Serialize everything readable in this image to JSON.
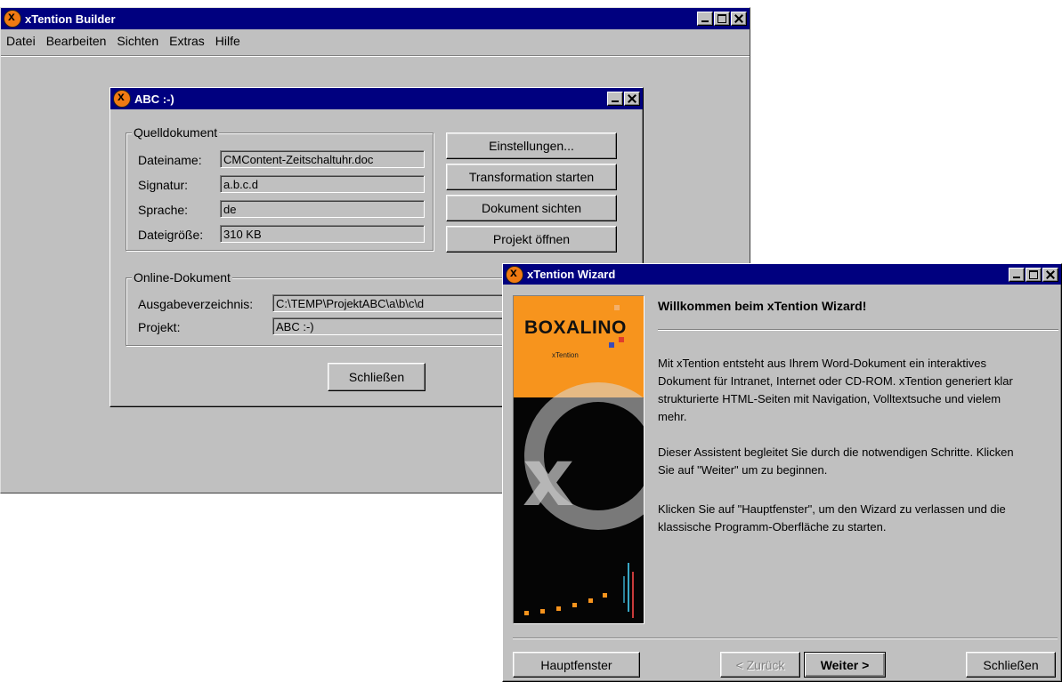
{
  "main_window": {
    "title": "xTention Builder",
    "menu": [
      "Datei",
      "Bearbeiten",
      "Sichten",
      "Extras",
      "Hilfe"
    ]
  },
  "abc_dialog": {
    "title": "ABC :-)",
    "source_group": {
      "label": "Quelldokument",
      "fields": [
        {
          "label": "Dateiname:",
          "value": "CMContent-Zeitschaltuhr.doc"
        },
        {
          "label": "Signatur:",
          "value": "a.b.c.d"
        },
        {
          "label": "Sprache:",
          "value": "de"
        },
        {
          "label": "Dateigröße:",
          "value": "310 KB"
        }
      ]
    },
    "buttons": [
      "Einstellungen...",
      "Transformation starten",
      "Dokument sichten",
      "Projekt öffnen"
    ],
    "online_group": {
      "label": "Online-Dokument",
      "fields": [
        {
          "label": "Ausgabeverzeichnis:",
          "value": "C:\\TEMP\\ProjektABC\\a\\b\\c\\d"
        },
        {
          "label": "Projekt:",
          "value": "ABC :-)"
        }
      ]
    },
    "close_label": "Schließen"
  },
  "wizard": {
    "title": "xTention Wizard",
    "heading": "Willkommen beim xTention Wizard!",
    "brand_name": "BOXALINO",
    "brand_sub": "xTention",
    "paragraph1": [
      "Mit xTention entsteht aus Ihrem Word-Dokument ein interaktives",
      "Dokument für Intranet, Internet oder CD-ROM. xTention generiert klar",
      "strukturierte HTML-Seiten mit Navigation, Volltextsuche und vielem",
      "mehr."
    ],
    "paragraph2": [
      "Dieser Assistent begleitet Sie durch die notwendigen Schritte. Klicken",
      "Sie auf \"Weiter\" um zu beginnen."
    ],
    "paragraph3": [
      "Klicken Sie auf \"Hauptfenster\", um den Wizard zu verlassen und die",
      "klassische Programm-Oberfläche zu starten."
    ],
    "buttons": {
      "main_window": "Hauptfenster",
      "back": "< Zurück",
      "next": "Weiter >",
      "close": "Schließen"
    },
    "colors": {
      "brand_orange": "#f7941d",
      "brand_dark": "#050505"
    }
  }
}
